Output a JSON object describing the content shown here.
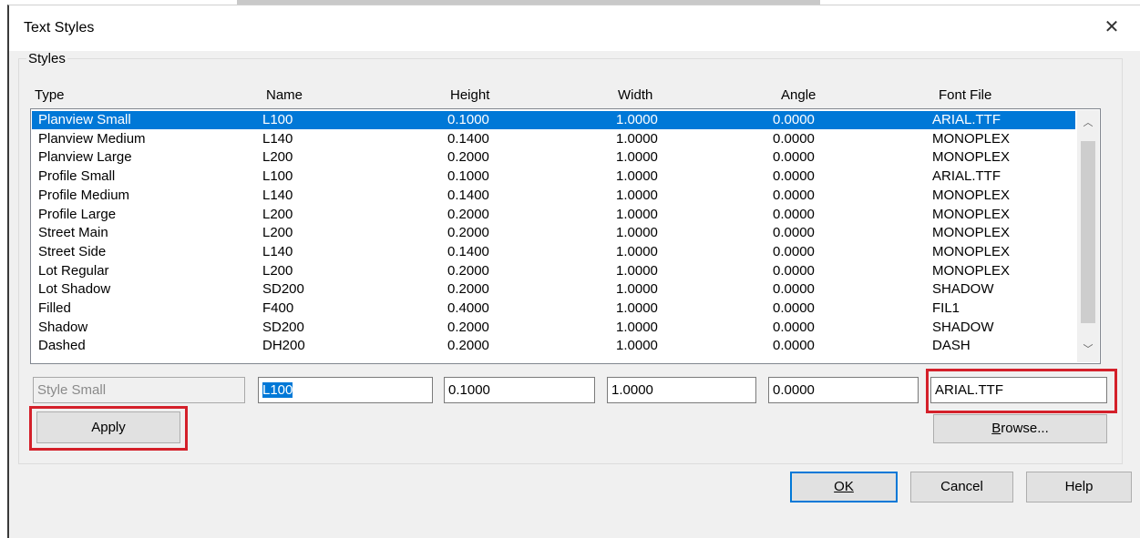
{
  "dialog": {
    "title": "Text Styles"
  },
  "styles_group": {
    "label": "Styles"
  },
  "columns": [
    "Type",
    "Name",
    "Height",
    "Width",
    "Angle",
    "Font File"
  ],
  "rows": [
    [
      "Planview Small",
      "L100",
      "0.1000",
      "1.0000",
      "0.0000",
      "ARIAL.TTF"
    ],
    [
      "Planview Medium",
      "L140",
      "0.1400",
      "1.0000",
      "0.0000",
      "MONOPLEX"
    ],
    [
      "Planview Large",
      "L200",
      "0.2000",
      "1.0000",
      "0.0000",
      "MONOPLEX"
    ],
    [
      "Profile Small",
      "L100",
      "0.1000",
      "1.0000",
      "0.0000",
      "ARIAL.TTF"
    ],
    [
      "Profile Medium",
      "L140",
      "0.1400",
      "1.0000",
      "0.0000",
      "MONOPLEX"
    ],
    [
      "Profile Large",
      "L200",
      "0.2000",
      "1.0000",
      "0.0000",
      "MONOPLEX"
    ],
    [
      "Street Main",
      "L200",
      "0.2000",
      "1.0000",
      "0.0000",
      "MONOPLEX"
    ],
    [
      "Street Side",
      "L140",
      "0.1400",
      "1.0000",
      "0.0000",
      "MONOPLEX"
    ],
    [
      "Lot Regular",
      "L200",
      "0.2000",
      "1.0000",
      "0.0000",
      "MONOPLEX"
    ],
    [
      "Lot Shadow",
      "SD200",
      "0.2000",
      "1.0000",
      "0.0000",
      "SHADOW"
    ],
    [
      "Filled",
      "F400",
      "0.4000",
      "1.0000",
      "0.0000",
      "FIL1"
    ],
    [
      "Shadow",
      "SD200",
      "0.2000",
      "1.0000",
      "0.0000",
      "SHADOW"
    ],
    [
      "Dashed",
      "DH200",
      "0.2000",
      "1.0000",
      "0.0000",
      "DASH"
    ]
  ],
  "selected_row": 0,
  "edit": {
    "type": "Style Small",
    "name": "L100",
    "height": "0.1000",
    "width": "1.0000",
    "angle": "0.0000",
    "font_file": "ARIAL.TTF"
  },
  "buttons": {
    "apply": "Apply",
    "browse": "Browse...",
    "ok": "OK",
    "cancel": "Cancel",
    "help": "Help"
  },
  "icons": {
    "close": "close-icon",
    "scroll_up": "chevron-up-icon",
    "scroll_down": "chevron-down-icon"
  },
  "colors": {
    "selection": "#0078d7",
    "highlight_box": "#d4202a",
    "dialog_bg": "#f0f0f0"
  }
}
